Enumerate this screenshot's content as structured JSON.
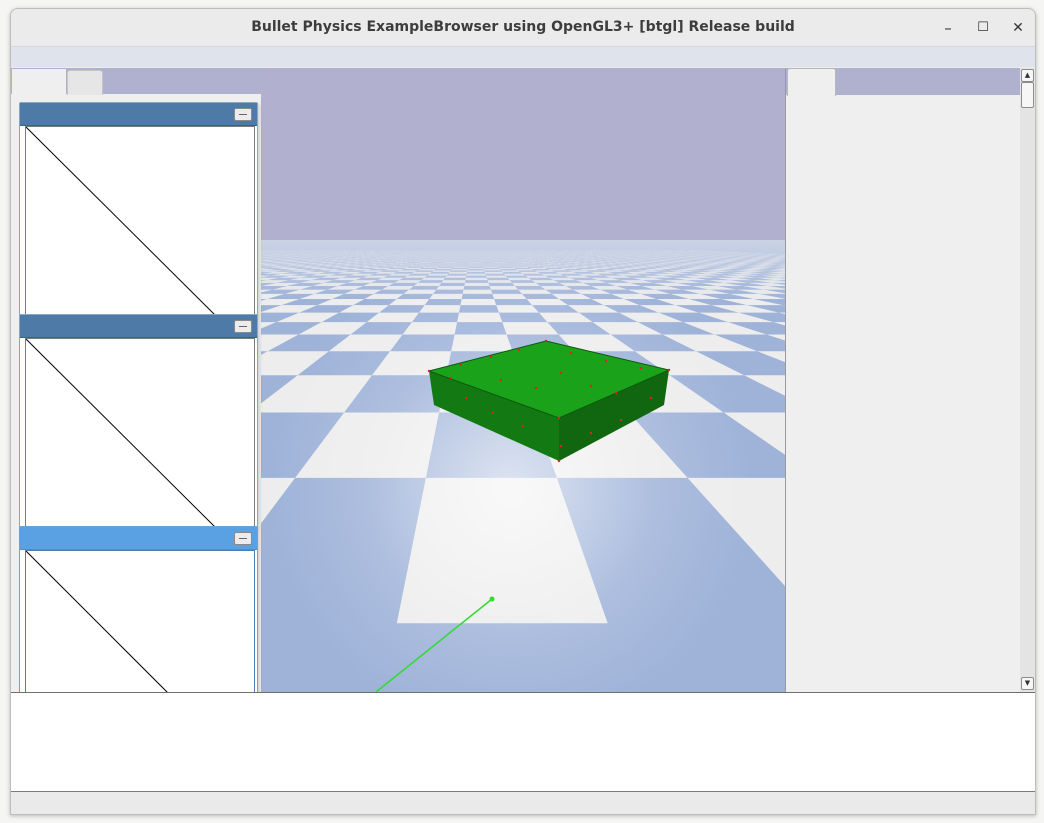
{
  "window": {
    "title": "Bullet Physics ExampleBrowser using OpenGL3+ [btgl] Release build",
    "minimize_glyph": "–",
    "maximize_glyph": "☐",
    "close_glyph": "✕"
  },
  "scene": {
    "sky_color": "#b1b1cf",
    "checker_blue": "#9fb3d9",
    "checker_white": "#ededed",
    "box_color": "#1aa31a"
  },
  "plot_windows": [
    {
      "state": "inactive"
    },
    {
      "state": "inactive"
    },
    {
      "state": "active"
    }
  ],
  "scrollbar": {
    "up_glyph": "▲",
    "down_glyph": "▼"
  }
}
